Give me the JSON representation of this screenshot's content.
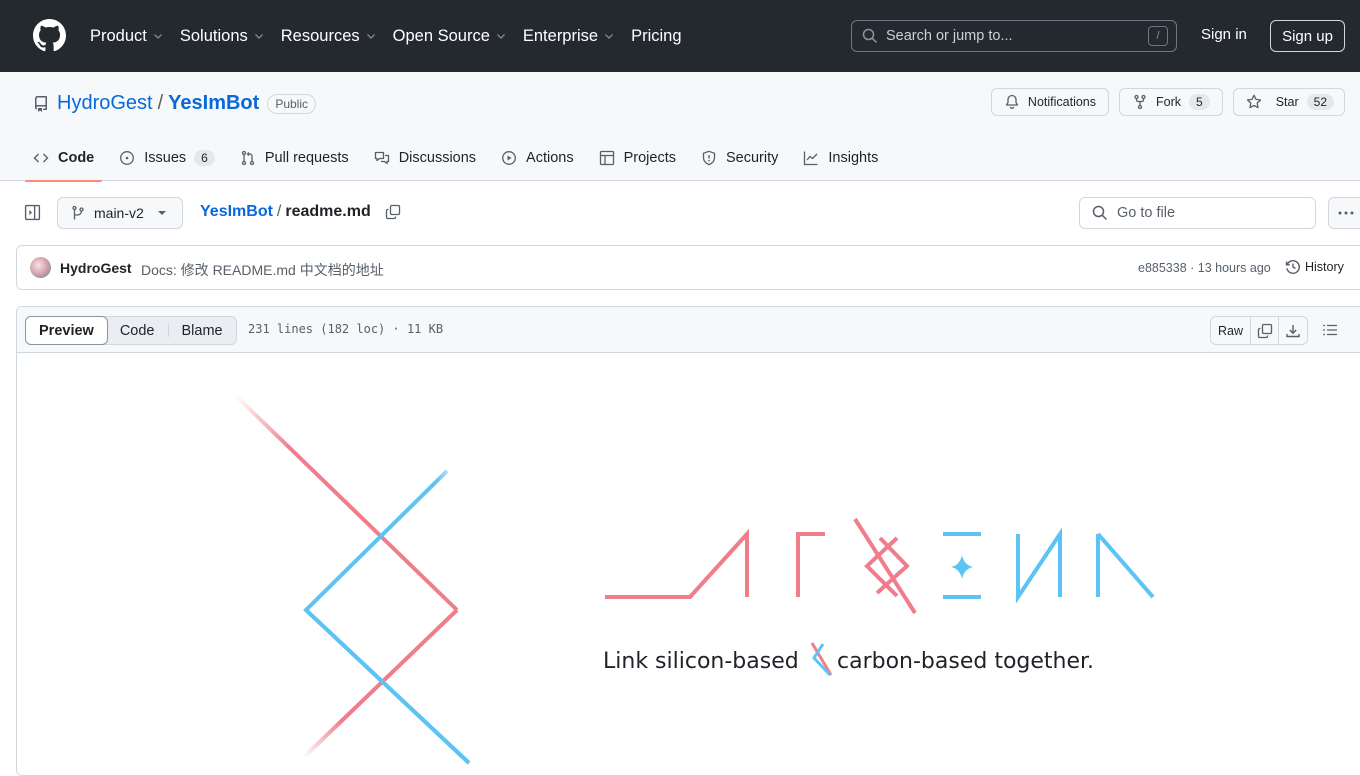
{
  "header": {
    "nav": [
      {
        "label": "Product",
        "has_menu": true
      },
      {
        "label": "Solutions",
        "has_menu": true
      },
      {
        "label": "Resources",
        "has_menu": true
      },
      {
        "label": "Open Source",
        "has_menu": true
      },
      {
        "label": "Enterprise",
        "has_menu": true
      },
      {
        "label": "Pricing",
        "has_menu": false
      }
    ],
    "search_placeholder": "Search or jump to...",
    "search_shortcut": "/",
    "sign_in": "Sign in",
    "sign_up": "Sign up"
  },
  "repo": {
    "owner": "HydroGest",
    "separator": "/",
    "name": "YesImBot",
    "visibility": "Public",
    "actions": {
      "notifications": "Notifications",
      "fork": "Fork",
      "fork_count": "5",
      "star": "Star",
      "star_count": "52"
    },
    "tabs": [
      {
        "label": "Code",
        "icon": "code-icon",
        "active": true,
        "count": null
      },
      {
        "label": "Issues",
        "icon": "issue-icon",
        "active": false,
        "count": "6"
      },
      {
        "label": "Pull requests",
        "icon": "pull-request-icon",
        "active": false,
        "count": null
      },
      {
        "label": "Discussions",
        "icon": "discussions-icon",
        "active": false,
        "count": null
      },
      {
        "label": "Actions",
        "icon": "play-icon",
        "active": false,
        "count": null
      },
      {
        "label": "Projects",
        "icon": "table-icon",
        "active": false,
        "count": null
      },
      {
        "label": "Security",
        "icon": "shield-icon",
        "active": false,
        "count": null
      },
      {
        "label": "Insights",
        "icon": "graph-icon",
        "active": false,
        "count": null
      }
    ]
  },
  "file_nav": {
    "branch": "main-v2",
    "breadcrumb_repo": "YesImBot",
    "breadcrumb_sep": "/",
    "file_name": "readme.md",
    "goto_placeholder": "Go to file"
  },
  "commit": {
    "author": "HydroGest",
    "message": "Docs: 修改 README.md 中文档的地址",
    "meta": "e885338 · 13 hours ago",
    "history": "History"
  },
  "file": {
    "views": [
      "Preview",
      "Code",
      "Blame"
    ],
    "active_view": "Preview",
    "info": "231 lines (182 loc) · 11 KB",
    "raw": "Raw"
  },
  "banner": {
    "logo_word": "ATHENA",
    "tagline_left": "Link silicon-based",
    "tagline_right": "carbon-based together.",
    "colors": {
      "pink": "#f07c8c",
      "blue": "#5bc4f5"
    }
  },
  "colors": {
    "header_bg": "#24292f",
    "link": "#0969da",
    "tab_underline": "#fd8c73",
    "border": "#d0d7de"
  }
}
